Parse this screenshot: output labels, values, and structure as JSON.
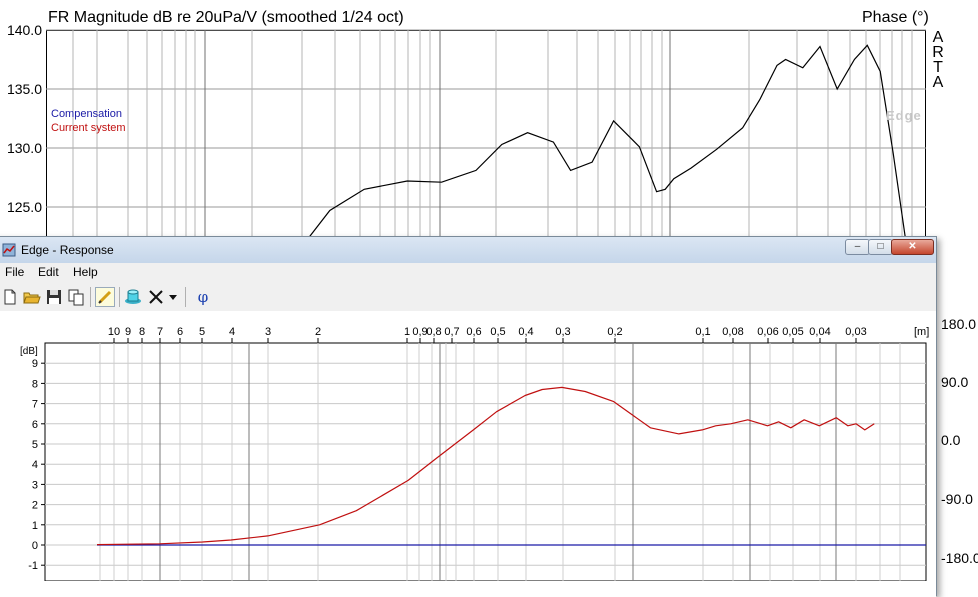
{
  "arta": {
    "title": "FR Magnitude dB re 20uPa/V (smoothed 1/24 oct)",
    "phase_label": "Phase (°)",
    "logo_letters": [
      "A",
      "R",
      "T",
      "A"
    ],
    "y_ticks": [
      "140.0",
      "135.0",
      "130.0",
      "125.0"
    ],
    "phase_ticks": [
      "180.0",
      "90.0",
      "0.0",
      "-90.0",
      "-180.0"
    ]
  },
  "edge": {
    "window_title": "Edge - Response",
    "menu": [
      "File",
      "Edit",
      "Help"
    ],
    "toolbar": {
      "icons": [
        "new-file-icon",
        "open-folder-icon",
        "save-icon",
        "copy-icon",
        "pen-icon",
        "edge-model-icon",
        "delete-icon",
        "dropdown-arrow-icon",
        "phi-icon"
      ],
      "phi_label": "φ"
    },
    "wavelength_ticks": [
      "10",
      "9",
      "8",
      "7",
      "6",
      "5",
      "4",
      "3",
      "2",
      "1",
      "0,9",
      "0,8",
      "0,7",
      "0,6",
      "0,5",
      "0,4",
      "0,3",
      "0,2",
      "0,1",
      "0,08",
      "0,06",
      "0,05",
      "0,04",
      "0,03"
    ],
    "wavelength_unit": "[m]",
    "y_unit": "[dB]",
    "y_ticks": [
      "9",
      "8",
      "7",
      "6",
      "5",
      "4",
      "3",
      "2",
      "1",
      "0",
      "-1"
    ],
    "legend": {
      "compensation": "Compensation",
      "current": "Current system"
    },
    "watermark": "Edge",
    "colors": {
      "compensation": "#1a1aa6",
      "current": "#c01010"
    }
  },
  "chart_data": [
    {
      "type": "line",
      "title": "FR Magnitude dB re 20uPa/V (smoothed 1/24 oct)",
      "ylabel": "",
      "ylim": [
        120,
        140
      ],
      "right_axis_label": "Phase (°)",
      "right_ylim": [
        -180,
        180
      ],
      "grid": true,
      "series": [
        {
          "values_note_x_unit": "relative log position 0-1",
          "x": [
            0.28,
            0.33,
            0.37,
            0.42,
            0.46,
            0.5,
            0.53,
            0.56,
            0.59,
            0.61,
            0.635,
            0.66,
            0.69,
            0.71,
            0.72,
            0.73,
            0.75,
            0.78,
            0.81,
            0.83,
            0.85,
            0.86,
            0.88,
            0.9,
            0.92,
            0.94,
            0.955,
            0.97,
            0.985,
            1.0
          ],
          "y": [
            120.0,
            124.7,
            126.5,
            127.2,
            127.1,
            128.1,
            130.3,
            131.3,
            130.5,
            128.1,
            128.8,
            132.3,
            130.1,
            126.3,
            126.5,
            127.4,
            128.3,
            129.9,
            131.7,
            134.1,
            137.0,
            137.5,
            136.8,
            138.6,
            135.0,
            137.5,
            138.7,
            136.5,
            129.6,
            122.0
          ]
        }
      ]
    },
    {
      "type": "line",
      "title": "",
      "xlabel": "[m]",
      "ylabel": "[dB]",
      "ylim": [
        -1.5,
        9.5
      ],
      "grid": true,
      "series": [
        {
          "name": "Compensation",
          "x": [
            10,
            0.03
          ],
          "y": [
            0,
            0
          ]
        },
        {
          "name": "Current system",
          "x": [
            10,
            7,
            5,
            4,
            3,
            2,
            1.5,
            1,
            0.8,
            0.6,
            0.5,
            0.4,
            0.35,
            0.3,
            0.25,
            0.2,
            0.15,
            0.12,
            0.1,
            0.09,
            0.08,
            0.07,
            0.06,
            0.055,
            0.05,
            0.045,
            0.04,
            0.035,
            0.032,
            0.03,
            0.028,
            0.026
          ],
          "y": [
            0.02,
            0.06,
            0.15,
            0.25,
            0.45,
            1.0,
            1.7,
            3.2,
            4.3,
            5.7,
            6.6,
            7.4,
            7.7,
            7.8,
            7.6,
            7.1,
            5.8,
            5.5,
            5.7,
            5.9,
            6.0,
            6.2,
            5.9,
            6.1,
            5.8,
            6.2,
            5.9,
            6.3,
            5.9,
            6.0,
            5.7,
            6.0
          ]
        }
      ]
    }
  ]
}
